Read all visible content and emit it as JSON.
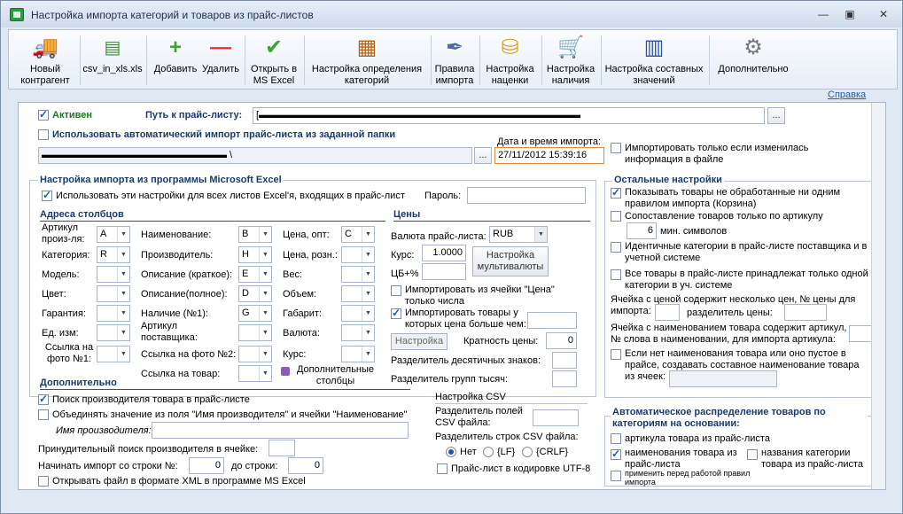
{
  "window": {
    "title": "Настройка импорта категорий и товаров из прайс-листов"
  },
  "toolbar": {
    "new_contractor": "Новый контрагент",
    "csv_in_xls": "csv_in_xls.xls",
    "add": "Добавить",
    "delete": "Удалить",
    "open_excel": "Открыть в MS Excel",
    "cat_settings": "Настройка определения категорий",
    "import_rules": "Правила импорта",
    "markup": "Настройка наценки",
    "stock": "Настройка наличия",
    "composite": "Настройка составных значений",
    "more": "Дополнительно",
    "help": "Справка"
  },
  "top": {
    "active": "Активен",
    "price_path_label": "Путь к прайс-листу:",
    "price_path_value": "[▬▬▬▬▬▬▬▬▬▬▬▬▬▬▬▬▬▬▬▬▬▬▬▬▬▬▬▬▬▬▬▬▬",
    "auto_import": "Использовать автоматический импорт прайс-листа из заданной папки",
    "folder_value": "▬▬▬▬▬▬▬▬▬▬▬▬▬▬▬▬▬▬▬ \\",
    "datetime_label": "Дата и время импорта:",
    "datetime_value": "27/11/2012 15:39:16",
    "only_changed": "Импортировать только если изменилась информация в файле",
    "browse": "..."
  },
  "excel": {
    "section_title": "Настройка импорта из программы Microsoft Excel",
    "use_for_all": "Использовать эти настройки для всех листов Excel'я, входящих в прайс-лист",
    "password_label": "Пароль:",
    "columns_title": "Адреса столбцов",
    "prices_title": "Цены",
    "article_label": "Артикул произ-ля:",
    "article_val": "A",
    "category_label": "Категория:",
    "category_val": "R",
    "model_label": "Модель:",
    "color_label": "Цвет:",
    "warranty_label": "Гарантия:",
    "unit_label": "Ед. изм:",
    "photo1_label": "Ссылка на фото №1:",
    "name_label": "Наименование:",
    "name_val": "B",
    "manufacturer_label": "Производитель:",
    "manufacturer_val": "H",
    "desc_short_label": "Описание (краткое):",
    "desc_short_val": "E",
    "desc_full_label": "Описание(полное):",
    "desc_full_val": "D",
    "stock_label": "Наличие (№1):",
    "stock_val": "G",
    "sup_article_label": "Артикул поставщика:",
    "photo2_label": "Ссылка на фото №2:",
    "product_link_label": "Ссылка на товар:",
    "price_opt_label": "Цена, опт:",
    "price_opt_val": "C",
    "price_retail_label": "Цена, розн.:",
    "weight_label": "Вес:",
    "volume_label": "Объем:",
    "size_label": "Габарит:",
    "currency_col_label": "Валюта:",
    "rate_col_label": "Курс:",
    "extra_cols": "Дополнительные столбцы",
    "currency_label": "Валюта прайс-листа:",
    "currency_val": "RUB",
    "rate_label": "Курс:",
    "rate_val": "1.0000",
    "cb_label": "ЦБ+%",
    "multicurrency": "Настройка мультивалюты",
    "import_from_price_cell": "Импортировать из ячейки \"Цена\" только числа",
    "import_price_gt": "Импортировать товары у которых цена больше чем:",
    "settings_btn": "Настройка",
    "price_precision_label": "Кратность цены:",
    "price_precision_val": "0",
    "decimal_sep_label": "Разделитель десятичных знаков:",
    "group_sep_label": "Разделитель групп тысяч:"
  },
  "extra": {
    "section_title": "Дополнительно",
    "find_manufacturer": "Поиск производителя товара в прайс-листе",
    "merge_manufacturer": "Объединять значение из поля \"Имя производителя\" и ячейки \"Наименование\"",
    "manufacturer_name_label": "Имя производителя:",
    "force_find_label": "Принудительный поиск производителя в ячейке:",
    "start_row_label": "Начинать импорт со строки №:",
    "start_row_val": "0",
    "to_row_label": "до строки:",
    "to_row_val": "0",
    "open_xml": "Открывать файл в формате XML в программе MS Excel"
  },
  "csv": {
    "title": "Настройка CSV",
    "field_sep_label": "Разделитель полей CSV файла:",
    "row_sep_label": "Разделитель строк CSV файла:",
    "opt_none": "Нет",
    "opt_lf": "{LF}",
    "opt_crlf": "{CRLF}",
    "utf8": "Прайс-лист в кодировке UTF-8"
  },
  "other": {
    "section_title": "Остальные настройки",
    "show_unprocessed": "Показывать товары не обработанные ни одним правилом импорта (Корзина)",
    "match_by_article": "Сопоставление товаров только по артикулу",
    "min_chars_val": "6",
    "min_chars_label": "мин. символов",
    "identical_categories": "Идентичные категории в прайс-листе поставщика и в учетной системе",
    "all_one_category": "Все товары в прайс-листе принадлежат только одной категории в уч. системе",
    "multi_price_label": "Ячейка с ценой содержит несколько цен, № цены для импорта:",
    "price_sep_label": "разделитель цены:",
    "word_num_label": "Ячейка с наименованием товара содержит артикул, № слова в наименовании, для импорта артикула:",
    "composite_name": "Если нет наименования товара или оно пустое в прайсе, создавать составное наименование товара из ячеек:"
  },
  "auto": {
    "section_title": "Автоматическое распределение товаров по категориям на основании:",
    "by_article": "артикула товара из прайс-листа",
    "by_name": "наименования товара из прайс-листа",
    "by_cat_names": "названия категории товара из прайс-листа",
    "apply_before": "применить перед работой правил импорта"
  },
  "colors": {
    "section": "#1a3a6e",
    "green_line": "#2b6a2a",
    "window_bg": "#dfe8f3"
  }
}
